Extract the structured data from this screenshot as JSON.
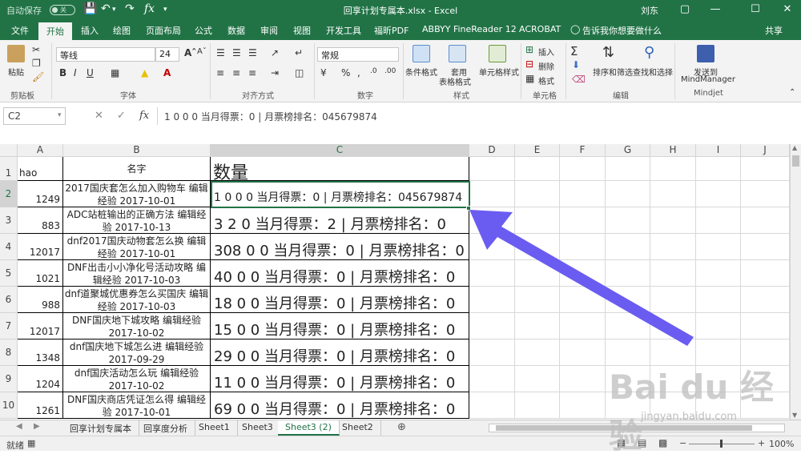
{
  "titlebar": {
    "autosave_label": "自动保存",
    "autosave_state": "关",
    "doc_title": "回享计划专属本.xlsx  -  Excel",
    "user": "刘东",
    "save_icon": "save-icon",
    "undo_icon": "undo-icon",
    "redo_icon": "redo-icon",
    "fx_icon": "function-icon"
  },
  "ribbon_tabs": [
    "文件",
    "开始",
    "插入",
    "绘图",
    "页面布局",
    "公式",
    "数据",
    "审阅",
    "视图",
    "开发工具",
    "福昕PDF",
    "ABBYY FineReader 12",
    "ACROBAT"
  ],
  "active_tab": "开始",
  "tell_me": "告诉我你想要做什么",
  "share": "共享",
  "ribbon": {
    "paste": "粘贴",
    "clipboard": "剪贴板",
    "font_name": "等线",
    "font_size": "24",
    "font_group": "字体",
    "align_group": "对齐方式",
    "number_format": "常规",
    "number_group": "数字",
    "cond_format": "条件格式",
    "table_format": "套用\n表格格式",
    "cell_style": "单元格样式",
    "styles_group": "样式",
    "insert": "插入",
    "delete": "删除",
    "format": "格式",
    "cells_group": "单元格",
    "sort_filter": "排序和筛选",
    "find_select": "查找和选择",
    "edit_group": "编辑",
    "send_to": "发送到",
    "mindmanager": "MindManager",
    "mindjet": "Mindjet"
  },
  "formula_bar": {
    "name_box": "C2",
    "content": "1 0 0 0 当月得票：0 | 月票榜排名：045679874"
  },
  "columns": [
    "A",
    "B",
    "C",
    "D",
    "E",
    "F",
    "G",
    "H",
    "I",
    "J"
  ],
  "header_row": {
    "a": "hao",
    "b": "名字",
    "c": "数量"
  },
  "rows": [
    {
      "n": "2",
      "a": "1249",
      "b": "2017国庆套怎么加入购物车 编辑经验 2017-10-01",
      "c": "1 0 0 0 当月得票：0 | 月票榜排名：045679874"
    },
    {
      "n": "3",
      "a": "883",
      "b": "ADC站桩输出的正确方法 编辑经验 2017-10-13",
      "c": "3 2 0 当月得票：2 | 月票榜排名：0"
    },
    {
      "n": "4",
      "a": "12017",
      "b": "dnf2017国庆动物套怎么换 编辑经验 2017-10-01",
      "c": "308 0 0 当月得票：0 | 月票榜排名：0"
    },
    {
      "n": "5",
      "a": "1021",
      "b": "DNF出击小小净化号活动攻略 编辑经验 2017-10-03",
      "c": "40 0 0 当月得票：0 | 月票榜排名：0"
    },
    {
      "n": "6",
      "a": "988",
      "b": "dnf道聚城优惠券怎么买国庆 编辑经验 2017-10-03",
      "c": "18 0 0 当月得票：0 | 月票榜排名：0"
    },
    {
      "n": "7",
      "a": "12017",
      "b": "DNF国庆地下城攻略 编辑经验 2017-10-02",
      "c": "15 0 0 当月得票：0 | 月票榜排名：0"
    },
    {
      "n": "8",
      "a": "1348",
      "b": "dnf国庆地下城怎么进 编辑经验 2017-09-29",
      "c": "29 0 0 当月得票：0 | 月票榜排名：0"
    },
    {
      "n": "9",
      "a": "1204",
      "b": "dnf国庆活动怎么玩 编辑经验 2017-10-02",
      "c": "11 0 0 当月得票：0 | 月票榜排名：0"
    },
    {
      "n": "10",
      "a": "1261",
      "b": "DNF国庆商店凭证怎么得 编辑经验 2017-10-01",
      "c": "69 0 0 当月得票：0 | 月票榜排名：0"
    }
  ],
  "sheet_tabs": [
    "回享计划专属本",
    "回享度分析",
    "Sheet1",
    "Sheet3",
    "Sheet3 (2)",
    "Sheet2"
  ],
  "active_sheet": "Sheet3 (2)",
  "status": {
    "mode": "就绪",
    "zoom": "100%"
  },
  "colors": {
    "accent": "#217346",
    "arrow": "#6a5cf0"
  },
  "watermark": {
    "brand": "Bai du 经验",
    "url": "jingyan.baidu.com"
  }
}
